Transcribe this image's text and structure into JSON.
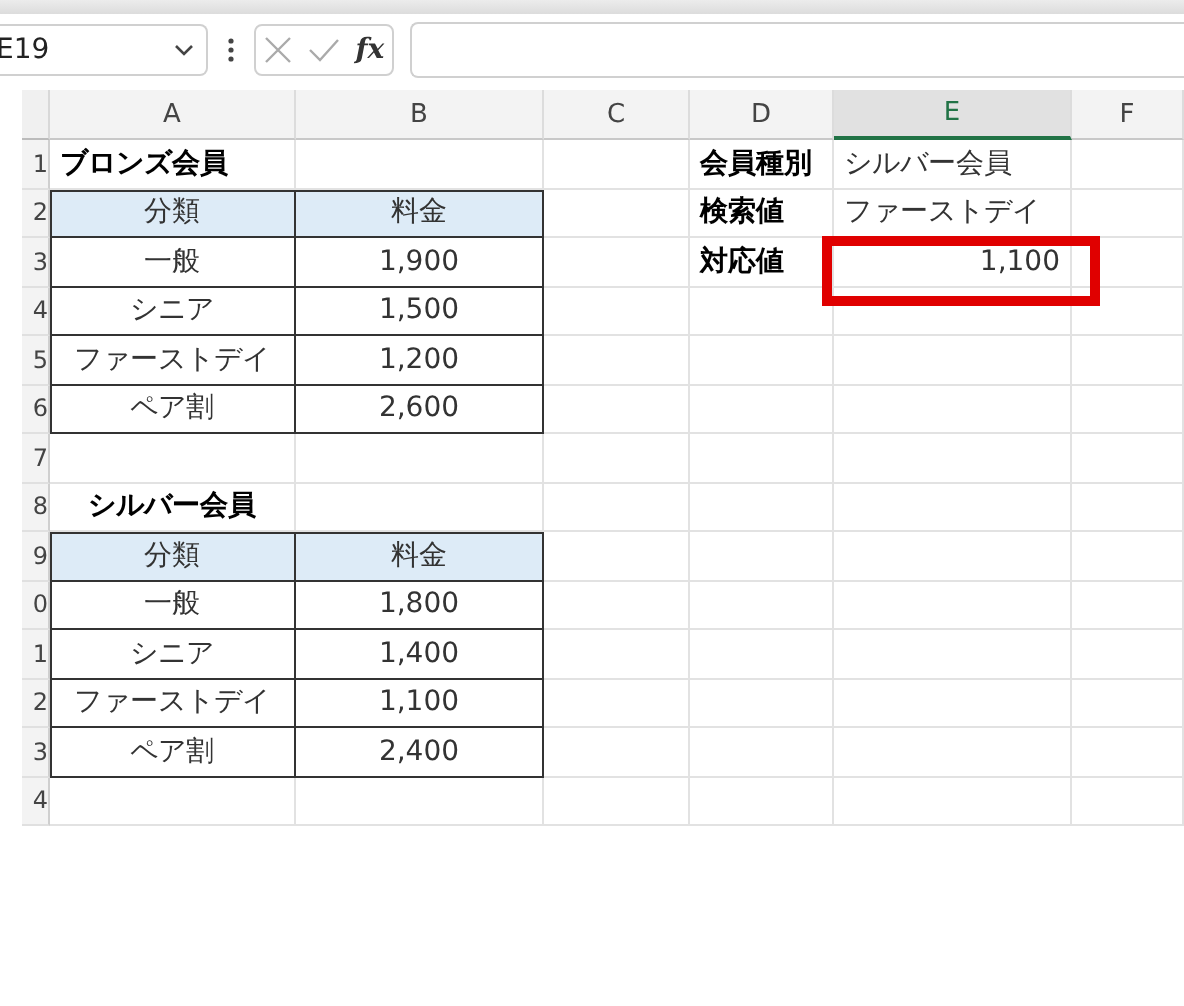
{
  "name_box": {
    "value": "E19"
  },
  "formula_bar": {
    "function_label": "fx"
  },
  "columns": [
    {
      "label": "A",
      "selected": false
    },
    {
      "label": "B",
      "selected": false
    },
    {
      "label": "C",
      "selected": false
    },
    {
      "label": "D",
      "selected": false
    },
    {
      "label": "E",
      "selected": true
    },
    {
      "label": "F",
      "selected": false
    }
  ],
  "row_numbers": [
    "1",
    "2",
    "3",
    "4",
    "5",
    "6",
    "7",
    "8",
    "9",
    "0",
    "1",
    "2",
    "3",
    "4"
  ],
  "tables": [
    {
      "title": "ブロンズ会員",
      "columns": [
        "分類",
        "料金"
      ],
      "rows": [
        [
          "一般",
          "1,900"
        ],
        [
          "シニア",
          "1,500"
        ],
        [
          "ファーストデイ",
          "1,200"
        ],
        [
          "ペア割",
          "2,600"
        ]
      ]
    },
    {
      "title": "シルバー会員",
      "columns": [
        "分類",
        "料金"
      ],
      "rows": [
        [
          "一般",
          "1,800"
        ],
        [
          "シニア",
          "1,400"
        ],
        [
          "ファーストデイ",
          "1,100"
        ],
        [
          "ペア割",
          "2,400"
        ]
      ]
    }
  ],
  "lookup": [
    {
      "label": "会員種別",
      "value": "シルバー会員",
      "highlighted": false
    },
    {
      "label": "検索値",
      "value": "ファーストデイ",
      "highlighted": false
    },
    {
      "label": "対応値",
      "value": "1,100",
      "highlighted": true
    }
  ]
}
